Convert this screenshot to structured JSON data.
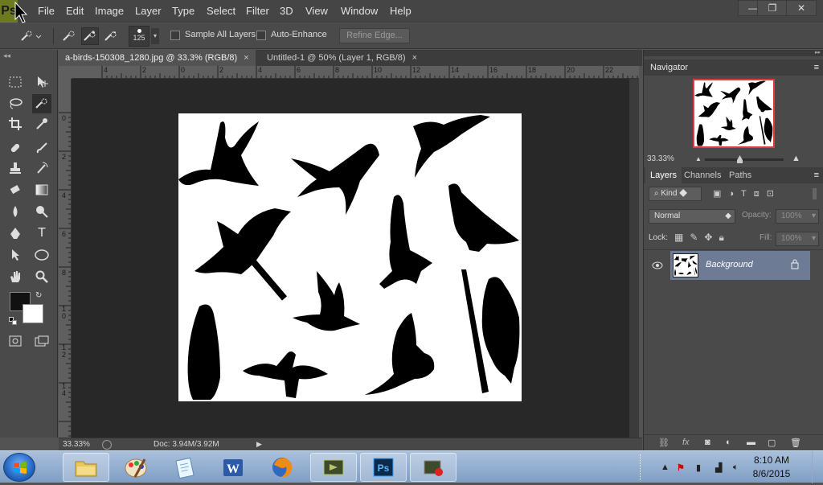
{
  "app": {
    "logo_text": "Ps"
  },
  "menu": [
    "File",
    "Edit",
    "Image",
    "Layer",
    "Type",
    "Select",
    "Filter",
    "3D",
    "View",
    "Window",
    "Help"
  ],
  "window_controls": {
    "minimize": "—",
    "restore": "❐",
    "close": "✕"
  },
  "options": {
    "brush_size": "125",
    "sample_all_layers": "Sample All Layers",
    "auto_enhance": "Auto-Enhance",
    "refine_edge": "Refine Edge..."
  },
  "tabs": [
    {
      "label": "a-birds-150308_1280.jpg @ 33.3% (RGB/8)",
      "close": "×"
    },
    {
      "label": "Untitled-1 @ 50% (Layer 1, RGB/8)",
      "close": "×"
    }
  ],
  "ruler_h": [
    "4",
    "2",
    "0",
    "2",
    "4",
    "6",
    "8",
    "10",
    "12",
    "14",
    "16",
    "18",
    "20",
    "22"
  ],
  "ruler_v": [
    "0",
    "2",
    "4",
    "6",
    "8",
    "1\n0",
    "1\n2",
    "1\n4"
  ],
  "status": {
    "zoom": "33.33%",
    "doc": "Doc: 3.94M/3.92M"
  },
  "navigator": {
    "title": "Navigator",
    "zoom": "33.33%"
  },
  "layers": {
    "tabs": [
      "Layers",
      "Channels",
      "Paths"
    ],
    "kind": "Kind",
    "blend_mode": "Normal",
    "opacity_label": "Opacity:",
    "opacity_value": "100%",
    "lock_label": "Lock:",
    "fill_label": "Fill:",
    "fill_value": "100%",
    "layer_name": "Background"
  },
  "taskbar": {
    "time": "8:10 AM",
    "date": "8/6/2015"
  },
  "icons": [
    "photoshop-logo",
    "mouse-cursor",
    "minimize-icon",
    "restore-icon",
    "close-icon",
    "quick-selection-icon",
    "eye-icon",
    "lock-icon",
    "folder-icon",
    "paint-icon",
    "notepad-icon",
    "word-icon",
    "firefox-icon",
    "photoshop-icon"
  ]
}
